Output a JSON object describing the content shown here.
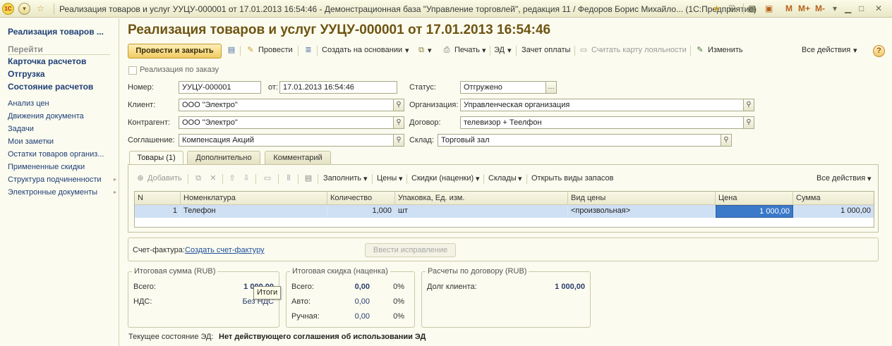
{
  "titlebar": {
    "logo": "1С",
    "title": "Реализация товаров и услуг УУЦУ-000001 от 17.01.2013 16:54:46 - Демонстрационная база \"Управление торговлей\", редакция 11 / Федоров Борис Михайло... (1С:Предприятие)",
    "m": "M",
    "m_plus": "M+",
    "m_minus": "M-"
  },
  "sidebar": {
    "doc_link": "Реализация товаров ...",
    "go_label": "Перейти",
    "bold_items": [
      "Карточка расчетов",
      "Отгрузка",
      "Состояние расчетов"
    ],
    "items": [
      "Анализ цен",
      "Движения документа",
      "Задачи",
      "Мои заметки",
      "Остатки товаров организ...",
      "Примененные скидки",
      "Структура подчиненности",
      "Электронные документы"
    ]
  },
  "document": {
    "title": "Реализация товаров и услуг УУЦУ-000001 от 17.01.2013 16:54:46"
  },
  "toolbar": {
    "post_close": "Провести и закрыть",
    "post": "Провести",
    "create_based": "Создать на основании",
    "print": "Печать",
    "ed": "ЭД",
    "payment_offset": "Зачет оплаты",
    "loyalty_card": "Считать карту лояльности",
    "edit": "Изменить",
    "all_actions": "Все действия",
    "help": "?"
  },
  "form": {
    "by_order_label": "Реализация по заказу",
    "number_label": "Номер:",
    "number_value": "УУЦУ-000001",
    "date_label": "от:",
    "date_value": "17.01.2013 16:54:46",
    "status_label": "Статус:",
    "status_value": "Отгружено",
    "client_label": "Клиент:",
    "client_value": "ООО \"Электро\"",
    "org_label": "Организация:",
    "org_value": "Управленческая организация",
    "counterparty_label": "Контрагент:",
    "counterparty_value": "ООО \"Электро\"",
    "contract_label": "Договор:",
    "contract_value": "телевизор + Теелфон",
    "agreement_label": "Соглашение:",
    "agreement_value": "Компенсация Акций",
    "warehouse_label": "Склад:",
    "warehouse_value": "Торговый зал"
  },
  "tabs": [
    "Товары (1)",
    "Дополнительно",
    "Комментарий"
  ],
  "goods_toolbar": {
    "add": "Добавить",
    "fill": "Заполнить",
    "prices": "Цены",
    "discounts": "Скидки (наценки)",
    "warehouses": "Склады",
    "open_stock_types": "Открыть виды запасов",
    "all_actions": "Все действия"
  },
  "table": {
    "columns": [
      "N",
      "Номенклатура",
      "Количество",
      "Упаковка, Ед. изм.",
      "Вид цены",
      "Цена",
      "Сумма"
    ],
    "rows": [
      [
        "1",
        "Телефон",
        "1,000",
        "шт",
        "<произвольная>",
        "1 000,00",
        "1 000,00"
      ]
    ]
  },
  "invoice": {
    "label": "Счет-фактура:",
    "link": "Создать счет-фактуру",
    "correction_button": "Ввести исправление"
  },
  "totals": {
    "title": "Итоговая сумма (RUB)",
    "total_label": "Всего:",
    "total_value": "1 000,00",
    "vat_label": "НДС:",
    "vat_value": "Без НДС",
    "tooltip": "Итоги"
  },
  "discount": {
    "title": "Итоговая скидка (наценка)",
    "total_label": "Всего:",
    "total_value": "0,00",
    "total_pct": "0%",
    "auto_label": "Авто:",
    "auto_value": "0,00",
    "auto_pct": "0%",
    "manual_label": "Ручная:",
    "manual_value": "0,00",
    "manual_pct": "0%"
  },
  "contract_settlements": {
    "title": "Расчеты по договору (RUB)",
    "debt_label": "Долг клиента:",
    "debt_value": "1 000,00"
  },
  "ed_status": {
    "label": "Текущее состояние ЭД:",
    "value": "Нет действующего соглашения об использовании ЭД"
  }
}
